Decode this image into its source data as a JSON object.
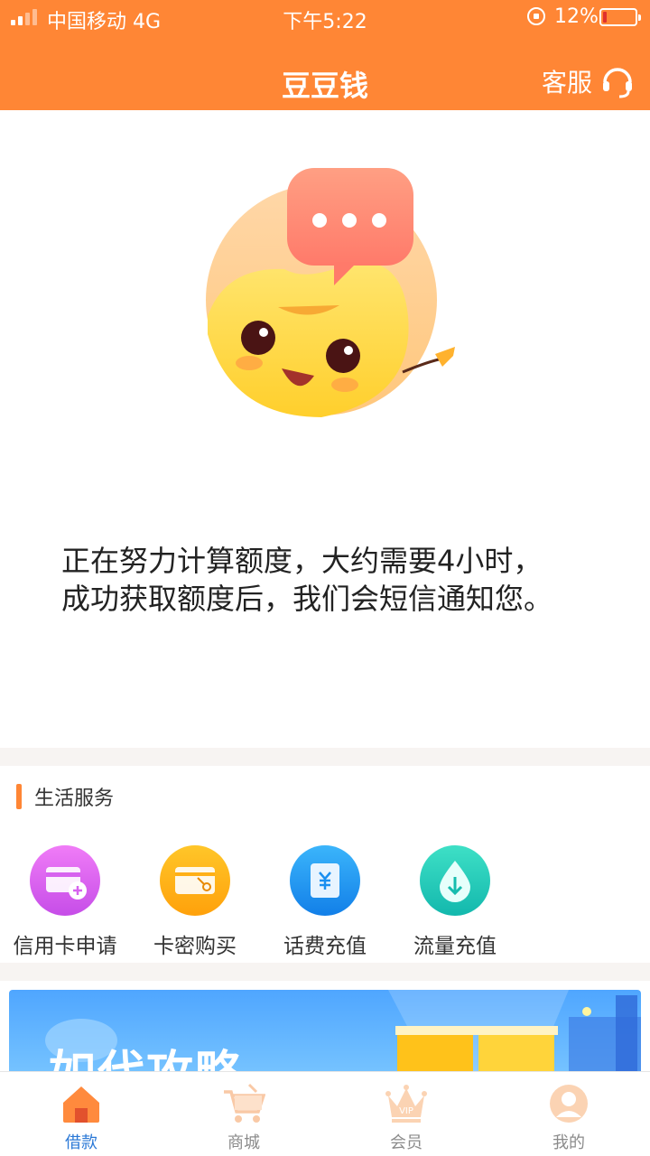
{
  "status_bar": {
    "carrier": "中国移动 4G",
    "time": "下午5:22",
    "battery": "12%",
    "battery_level": 0.12
  },
  "header": {
    "title": "豆豆钱",
    "service_label": "客服",
    "service_icon": "headset-icon"
  },
  "main": {
    "message_line1": "正在努力计算额度，大约需要4小时，",
    "message_line2": "成功获取额度后，我们会短信通知您。"
  },
  "life_services": {
    "title": "生活服务",
    "items": [
      {
        "label": "信用卡申请",
        "icon": "credit-card-icon",
        "color": "#d660f0"
      },
      {
        "label": "卡密购买",
        "icon": "card-key-icon",
        "color": "#ffb413"
      },
      {
        "label": "话费充值",
        "icon": "yuan-recharge-icon",
        "color": "#1ea2f5"
      },
      {
        "label": "流量充值",
        "icon": "data-drop-icon",
        "color": "#22cdb9"
      }
    ]
  },
  "banner": {
    "text": "如代攻略"
  },
  "tabbar": {
    "items": [
      {
        "label": "借款",
        "icon": "home-icon",
        "active": true
      },
      {
        "label": "商城",
        "icon": "cart-icon",
        "active": false
      },
      {
        "label": "会员",
        "icon": "vip-crown-icon",
        "active": false
      },
      {
        "label": "我的",
        "icon": "profile-icon",
        "active": false
      }
    ]
  },
  "colors": {
    "brand": "#ff8635",
    "tab_active": "#2a78d6",
    "tab_inactive": "#8b8b8b"
  }
}
